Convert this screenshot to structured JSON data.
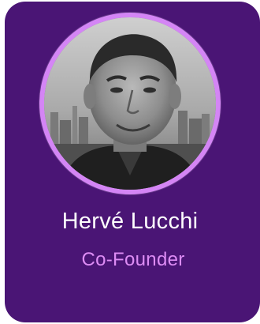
{
  "profile": {
    "name": "Hervé Lucchi",
    "role": "Co-Founder",
    "photo": "headshot-photo"
  },
  "colors": {
    "card_background": "#4a1575",
    "avatar_ring": "#d485f5",
    "name_text": "#ffffff",
    "role_text": "#dd8cf4"
  }
}
